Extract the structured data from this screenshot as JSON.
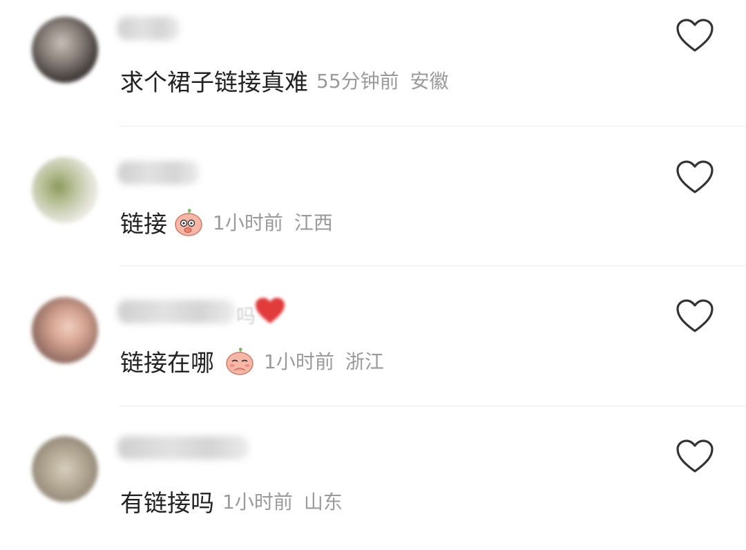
{
  "comments": [
    {
      "text": "求个裙子链接真难",
      "time": "55分钟前",
      "location": "安徽",
      "emoji": ""
    },
    {
      "text": "链接",
      "time": "1小时前",
      "location": "江西",
      "emoji": "peach-face-emoji"
    },
    {
      "text": "链接在哪",
      "time": "1小时前",
      "location": "浙江",
      "emoji": "peach-face-emoji"
    },
    {
      "text": "有链接吗",
      "time": "1小时前",
      "location": "山东",
      "emoji": ""
    }
  ],
  "username_fragment": "吗",
  "colors": {
    "text": "#222222",
    "meta": "#9a9a9a",
    "heart": "#333333",
    "divider": "#ececec"
  },
  "icons": [
    "heart-outline-icon",
    "peach-face-emoji"
  ]
}
